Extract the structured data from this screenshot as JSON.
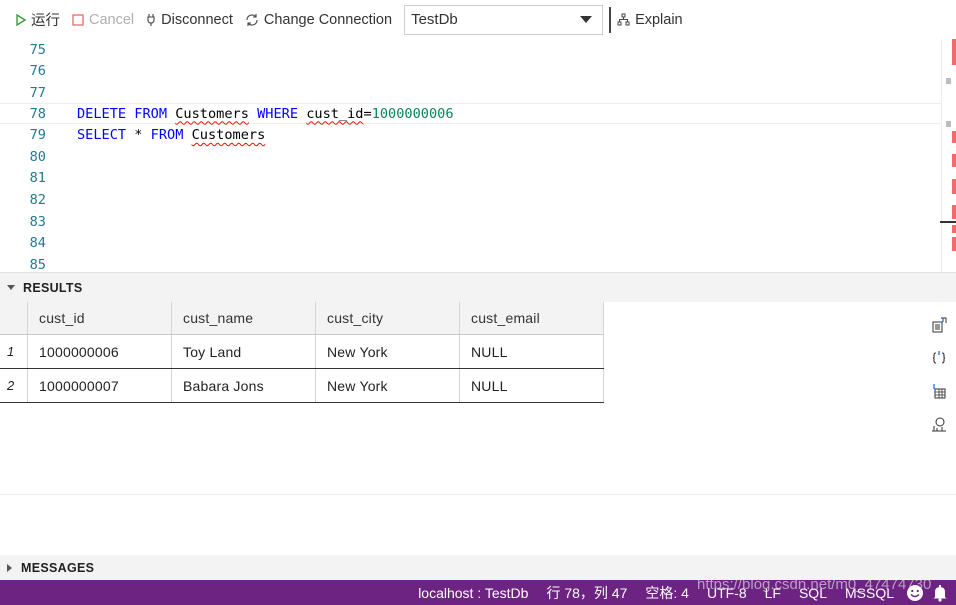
{
  "toolbar": {
    "run_label": "运行",
    "cancel_label": "Cancel",
    "disconnect_label": "Disconnect",
    "change_connection_label": "Change Connection",
    "database": "TestDb",
    "explain_label": "Explain"
  },
  "editor": {
    "lines": [
      {
        "num": "75",
        "code": ""
      },
      {
        "num": "76",
        "code": ""
      },
      {
        "num": "77",
        "code": ""
      },
      {
        "num": "78",
        "code": "DELETE FROM Customers WHERE cust_id=1000000006"
      },
      {
        "num": "79",
        "code": "SELECT * FROM Customers"
      },
      {
        "num": "80",
        "code": ""
      },
      {
        "num": "81",
        "code": ""
      },
      {
        "num": "82",
        "code": ""
      },
      {
        "num": "83",
        "code": ""
      },
      {
        "num": "84",
        "code": ""
      },
      {
        "num": "85",
        "code": ""
      }
    ],
    "tokens": {
      "delete": "DELETE",
      "from": "FROM",
      "customers": "Customers",
      "where": "WHERE",
      "cust_id": "cust_id",
      "eq": "=",
      "id_value": "1000000006",
      "select": "SELECT",
      "star": "*"
    }
  },
  "results": {
    "title": "RESULTS",
    "columns": [
      "cust_id",
      "cust_name",
      "cust_city",
      "cust_email"
    ],
    "rows": [
      {
        "index": "1",
        "cells": [
          "1000000006",
          "Toy Land",
          "New York",
          "NULL"
        ]
      },
      {
        "index": "2",
        "cells": [
          "1000000007",
          "Babara Jons",
          "New York",
          "NULL"
        ]
      }
    ],
    "side_icons": [
      "save-csv-icon",
      "save-json-icon",
      "save-excel-icon",
      "chart-icon"
    ]
  },
  "messages": {
    "title": "MESSAGES"
  },
  "statusbar": {
    "connection": "localhost : TestDb",
    "position": "行 78，列 47",
    "indent": "空格: 4",
    "encoding": "UTF-8",
    "eol": "LF",
    "language": "SQL",
    "provider": "MSSQL",
    "watermark": "https://blog.csdn.net/m0_47474730"
  },
  "colors": {
    "statusbar": "#6c2381",
    "keyword": "#0000ff",
    "number": "#098658",
    "line_number": "#237893",
    "run_icon": "#3c9a3c",
    "cancel_icon": "#e06060"
  }
}
